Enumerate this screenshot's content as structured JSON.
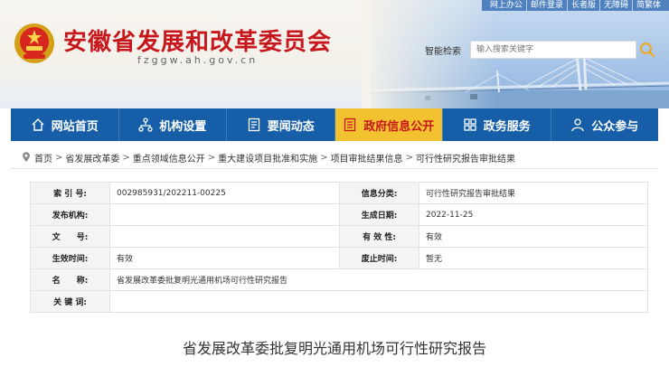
{
  "top_links": [
    "网上办公",
    "邮件登录",
    "长者版",
    "无障碍",
    "简繁体"
  ],
  "site": {
    "title": "安徽省发展和改革委员会",
    "domain": "fzggw.ah.gov.cn"
  },
  "search": {
    "label": "智能检索",
    "placeholder": "输入搜索关键字"
  },
  "nav": [
    {
      "label": "网站首页",
      "icon": "home-icon"
    },
    {
      "label": "机构设置",
      "icon": "org-icon"
    },
    {
      "label": "要闻动态",
      "icon": "news-icon"
    },
    {
      "label": "政府信息公开",
      "icon": "disclosure-icon",
      "active": true
    },
    {
      "label": "政务服务",
      "icon": "service-icon"
    },
    {
      "label": "公众参与",
      "icon": "participation-icon"
    }
  ],
  "breadcrumb": [
    "首页",
    "省发展改革委",
    "重点领域信息公开",
    "重大建设项目批准和实施",
    "项目审批结果信息",
    "可行性研究报告审批结果"
  ],
  "info": {
    "index_label": "索 引 号:",
    "index_value": "002985931/202211-00225",
    "category_label": "信息分类:",
    "category_value": "可行性研究报告审批结果",
    "publisher_label": "发布机构:",
    "publisher_value": "",
    "date_label": "生成日期:",
    "date_value": "2022-11-25",
    "docno_label": "文　　号:",
    "docno_value": "",
    "validity_label": "有 效 性:",
    "validity_value": "有效",
    "effective_label": "生效时间:",
    "effective_value": "有效",
    "repeal_label": "废止时间:",
    "repeal_value": "暂无",
    "name_label": "名　　称:",
    "name_value": "省发展改革委批复明光通用机场可行性研究报告",
    "keywords_label": "关 键 词:",
    "keywords_value": ""
  },
  "doc_title": "省发展改革委批复明光通用机场可行性研究报告",
  "colors": {
    "brand_red": "#c8161d",
    "nav_blue": "#165fa8",
    "nav_active": "#f2c230"
  }
}
